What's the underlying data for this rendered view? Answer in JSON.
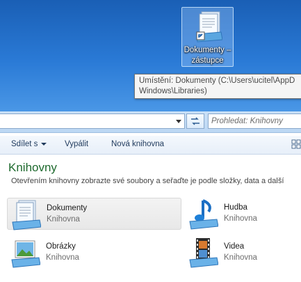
{
  "desktop": {
    "shortcut_label": "Dokumenty – zástupce",
    "tooltip_line1": "Umístění: Dokumenty (C:\\Users\\ucitel\\AppD",
    "tooltip_line2": "Windows\\Libraries)"
  },
  "address": {
    "search_placeholder": "Prohledat: Knihovny"
  },
  "toolbar": {
    "share_label": "Sdílet s",
    "burn_label": "Vypálit",
    "new_library_label": "Nová knihovna"
  },
  "main": {
    "heading": "Knihovny",
    "subtitle": "Otevřením knihovny zobrazte své soubory a seřaďte je podle složky, data a další",
    "libraries": [
      {
        "name": "Dokumenty",
        "type": "Knihovna",
        "icon": "documents-library-icon"
      },
      {
        "name": "Hudba",
        "type": "Knihovna",
        "icon": "music-library-icon"
      },
      {
        "name": "Obrázky",
        "type": "Knihovna",
        "icon": "pictures-library-icon"
      },
      {
        "name": "Videa",
        "type": "Knihovna",
        "icon": "videos-library-icon"
      }
    ]
  },
  "colors": {
    "heading_green": "#1e6a2e",
    "desktop_blue": "#1f6bc2",
    "toolbar_text": "#1e395b"
  }
}
